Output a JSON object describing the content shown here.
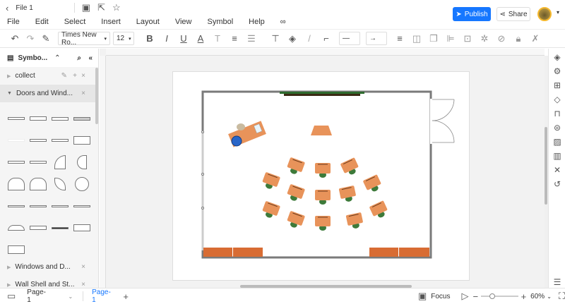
{
  "titlebar": {
    "file_name": "File 1"
  },
  "menu": [
    "File",
    "Edit",
    "Select",
    "Insert",
    "Layout",
    "View",
    "Symbol",
    "Help"
  ],
  "toolbar": {
    "font": "Times New Ro...",
    "size": "12"
  },
  "header": {
    "publish": "Publish",
    "share": "Share"
  },
  "sidebar": {
    "title": "Symbo...",
    "groups": [
      {
        "label": "collect"
      },
      {
        "label": "Doors and Wind..."
      },
      {
        "label": "Windows and D..."
      },
      {
        "label": "Wall Shell and St..."
      }
    ]
  },
  "status": {
    "page_select": "Page-1",
    "page_tab": "Page-1",
    "focus": "Focus",
    "zoom": "60%"
  },
  "colors": {
    "accent": "#1677ff",
    "desk": "#e8935a",
    "cabinet": "#d86c33",
    "board": "#2e6b2e"
  }
}
